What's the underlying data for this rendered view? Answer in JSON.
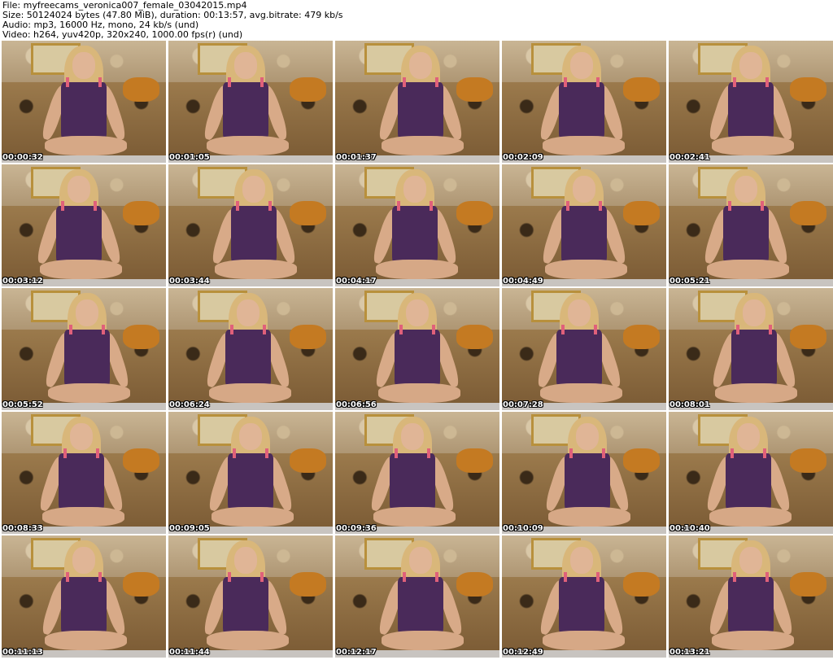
{
  "header": {
    "file_line": "File: myfreecams_veronica007_female_03042015.mp4",
    "size_line": "Size: 50124024 bytes (47.80 MiB), duration: 00:13:57, avg.bitrate: 479 kb/s",
    "audio_line": "Audio: mp3, 16000 Hz, mono, 24 kb/s (und)",
    "video_line": "Video: h264, yuv420p, 320x240, 1000.00 fps(r) (und)"
  },
  "thumbnails": [
    {
      "time": "00:00:32"
    },
    {
      "time": "00:01:05"
    },
    {
      "time": "00:01:37"
    },
    {
      "time": "00:02:09"
    },
    {
      "time": "00:02:41"
    },
    {
      "time": "00:03:12"
    },
    {
      "time": "00:03:44"
    },
    {
      "time": "00:04:17"
    },
    {
      "time": "00:04:49"
    },
    {
      "time": "00:05:21"
    },
    {
      "time": "00:05:52"
    },
    {
      "time": "00:06:24"
    },
    {
      "time": "00:06:56"
    },
    {
      "time": "00:07:28"
    },
    {
      "time": "00:08:01"
    },
    {
      "time": "00:08:33"
    },
    {
      "time": "00:09:05"
    },
    {
      "time": "00:09:36"
    },
    {
      "time": "00:10:09"
    },
    {
      "time": "00:10:40"
    },
    {
      "time": "00:11:13"
    },
    {
      "time": "00:11:44"
    },
    {
      "time": "00:12:17"
    },
    {
      "time": "00:12:49"
    },
    {
      "time": "00:13:21"
    }
  ]
}
